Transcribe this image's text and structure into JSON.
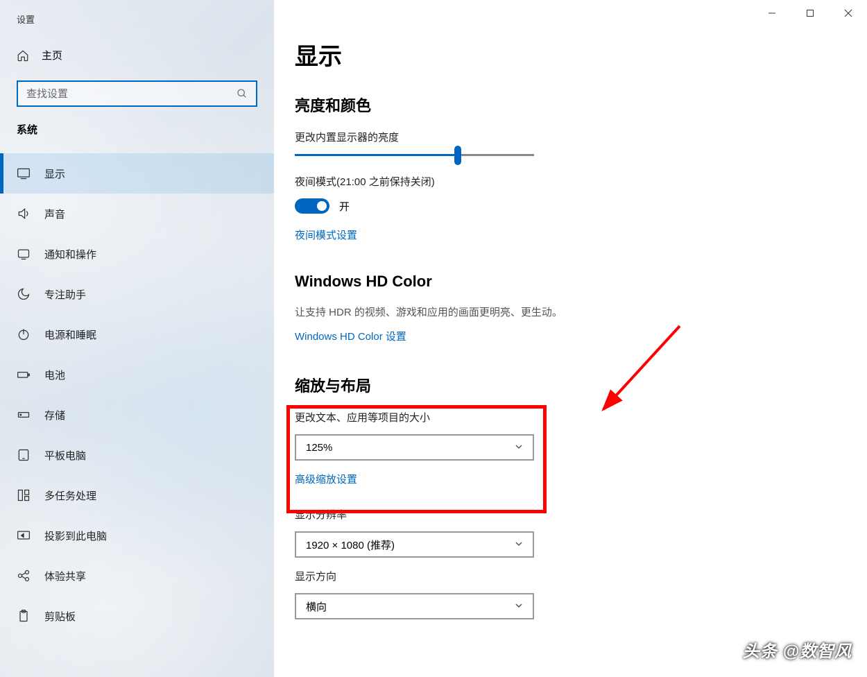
{
  "window": {
    "app_title": "设置"
  },
  "sidebar": {
    "home_label": "主页",
    "search_placeholder": "查找设置",
    "section": "系统",
    "items": [
      {
        "icon": "display",
        "label": "显示",
        "active": true
      },
      {
        "icon": "sound",
        "label": "声音"
      },
      {
        "icon": "notifications",
        "label": "通知和操作"
      },
      {
        "icon": "focus",
        "label": "专注助手"
      },
      {
        "icon": "power",
        "label": "电源和睡眠"
      },
      {
        "icon": "battery",
        "label": "电池"
      },
      {
        "icon": "storage",
        "label": "存储"
      },
      {
        "icon": "tablet",
        "label": "平板电脑"
      },
      {
        "icon": "multitask",
        "label": "多任务处理"
      },
      {
        "icon": "project",
        "label": "投影到此电脑"
      },
      {
        "icon": "shared",
        "label": "体验共享"
      },
      {
        "icon": "clipboard",
        "label": "剪贴板"
      }
    ]
  },
  "main": {
    "title": "显示",
    "brightness": {
      "heading": "亮度和颜色",
      "label": "更改内置显示器的亮度",
      "slider_percent": 68,
      "night_label": "夜间模式(21:00 之前保持关闭)",
      "toggle_label": "开",
      "settings_link": "夜间模式设置"
    },
    "hd": {
      "heading": "Windows HD Color",
      "desc": "让支持 HDR 的视频、游戏和应用的画面更明亮、更生动。",
      "link": "Windows HD Color 设置"
    },
    "scale": {
      "heading": "缩放与布局",
      "label": "更改文本、应用等项目的大小",
      "scale_value": "125%",
      "advanced_link": "高级缩放设置",
      "resolution_label": "显示分辨率",
      "resolution_value": "1920 × 1080 (推荐)",
      "orientation_label": "显示方向",
      "orientation_value": "横向"
    }
  },
  "watermark": "头条 @数智风"
}
